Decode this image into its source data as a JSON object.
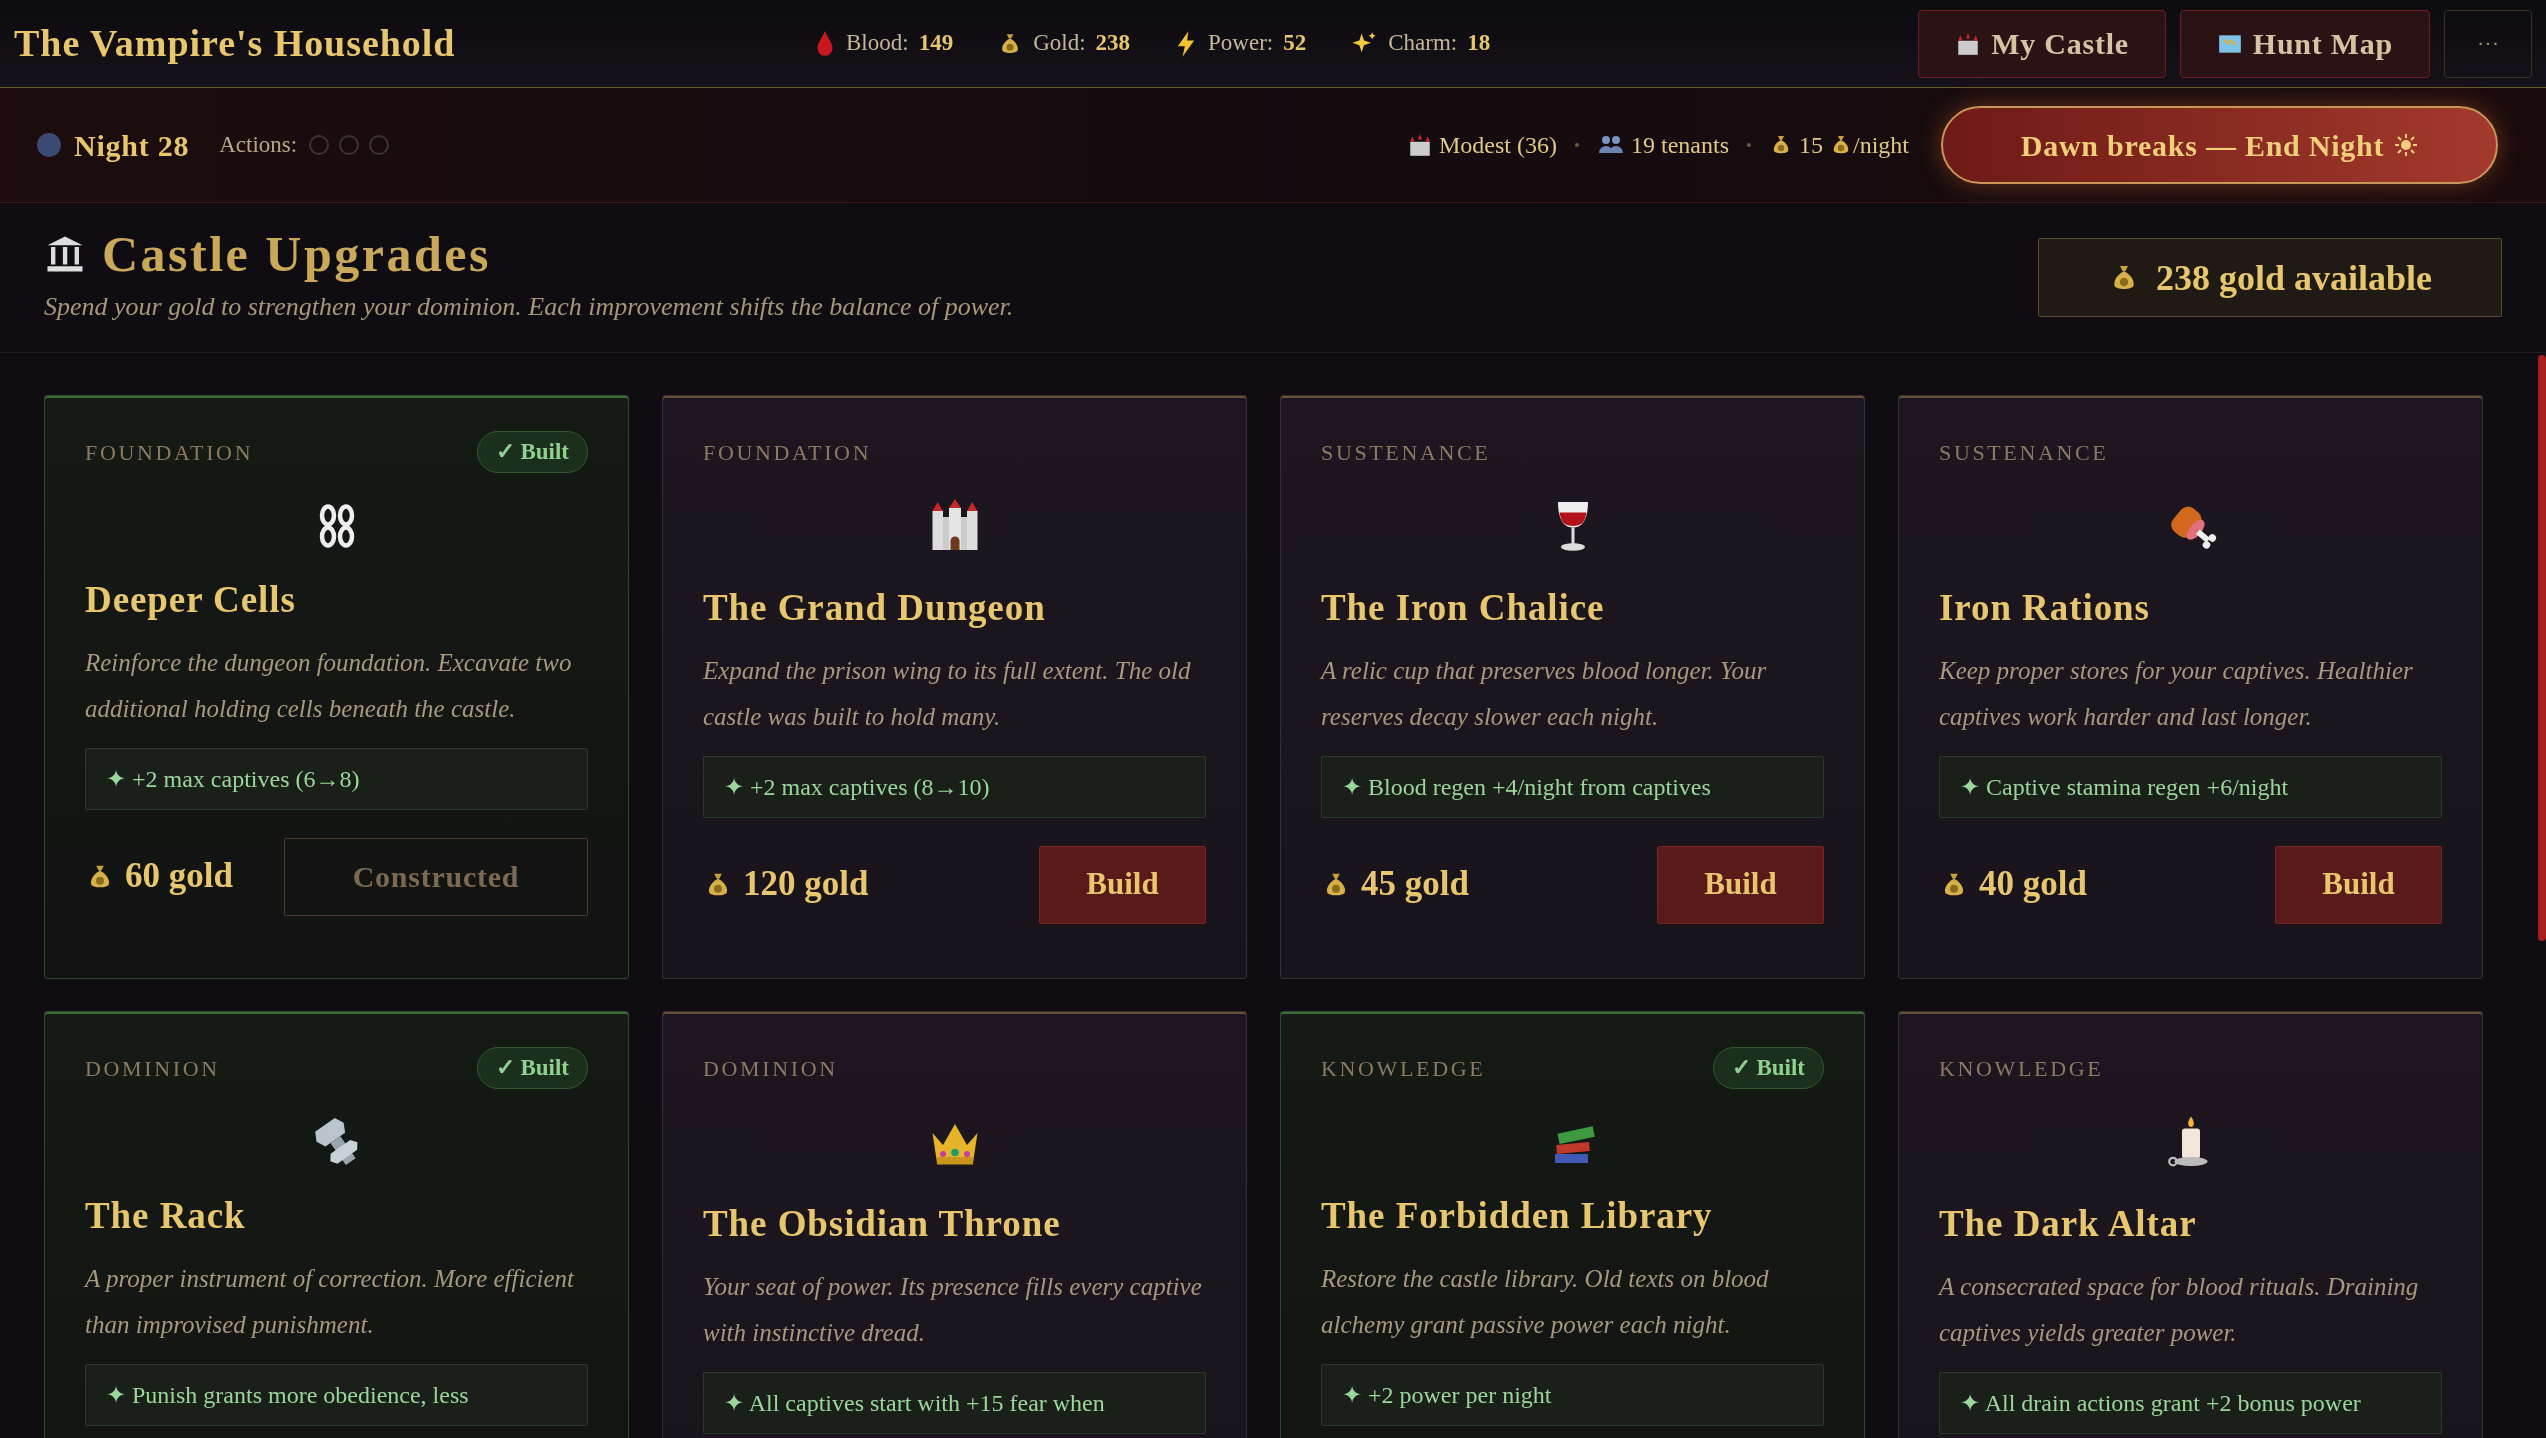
{
  "app_title": "The Vampire's Household",
  "stats": [
    {
      "label": "Blood:",
      "value": "149"
    },
    {
      "label": "Gold:",
      "value": "238"
    },
    {
      "label": "Power:",
      "value": "52"
    },
    {
      "label": "Charm:",
      "value": "18"
    }
  ],
  "nav_buttons": [
    "My Castle",
    "Hunt Map"
  ],
  "more_button": "···",
  "night": "Night 28",
  "actions": {
    "label": "Actions:",
    "slots": [
      {
        "used": false
      },
      {
        "used": false
      },
      {
        "used": false
      }
    ]
  },
  "castle_info": [
    {
      "text": "Modest (36)"
    },
    {
      "text": "19 tenants"
    },
    {
      "text": "15",
      "suffix": "/night"
    }
  ],
  "end_night_button": "Dawn breaks — End Night",
  "section": {
    "title": "Castle Upgrades",
    "subtitle": "Spend your gold to strengthen your dominion. Each improvement shifts the balance of power.",
    "gold_available": "238 gold available"
  },
  "upgrades": [
    {
      "category": "FOUNDATION",
      "built": true,
      "badge": "✓ Built",
      "title": "Deeper Cells",
      "description": "Reinforce the dungeon foundation. Excavate two additional holding cells beneath the castle.",
      "effect": "✦ +2 max captives (6→8)",
      "cost": "60 gold",
      "button": "Constructed"
    },
    {
      "category": "FOUNDATION",
      "built": false,
      "title": "The Grand Dungeon",
      "description": "Expand the prison wing to its full extent. The old castle was built to hold many.",
      "effect": "✦ +2 max captives (8→10)",
      "cost": "120 gold",
      "button": "Build"
    },
    {
      "category": "SUSTENANCE",
      "built": false,
      "title": "The Iron Chalice",
      "description": "A relic cup that preserves blood longer. Your reserves decay slower each night.",
      "effect": "✦ Blood regen +4/night from captives",
      "cost": "45 gold",
      "button": "Build"
    },
    {
      "category": "SUSTENANCE",
      "built": false,
      "title": "Iron Rations",
      "description": "Keep proper stores for your captives. Healthier captives work harder and last longer.",
      "effect": "✦ Captive stamina regen +6/night",
      "cost": "40 gold",
      "button": "Build"
    },
    {
      "category": "DOMINION",
      "built": true,
      "badge": "✓ Built",
      "title": "The Rack",
      "description": "A proper instrument of correction. More efficient than improvised punishment.",
      "effect": "✦ Punish grants more obedience, less"
    },
    {
      "category": "DOMINION",
      "built": false,
      "title": "The Obsidian Throne",
      "description": "Your seat of power. Its presence fills every captive with instinctive dread.",
      "effect": "✦ All captives start with +15 fear when"
    },
    {
      "category": "KNOWLEDGE",
      "built": true,
      "badge": "✓ Built",
      "title": "The Forbidden Library",
      "description": "Restore the castle library. Old texts on blood alchemy grant passive power each night.",
      "effect": "✦ +2 power per night"
    },
    {
      "category": "KNOWLEDGE",
      "built": false,
      "title": "The Dark Altar",
      "description": "A consecrated space for blood rituals. Draining captives yields greater power.",
      "effect": "✦ All drain actions grant +2 bonus power"
    }
  ]
}
